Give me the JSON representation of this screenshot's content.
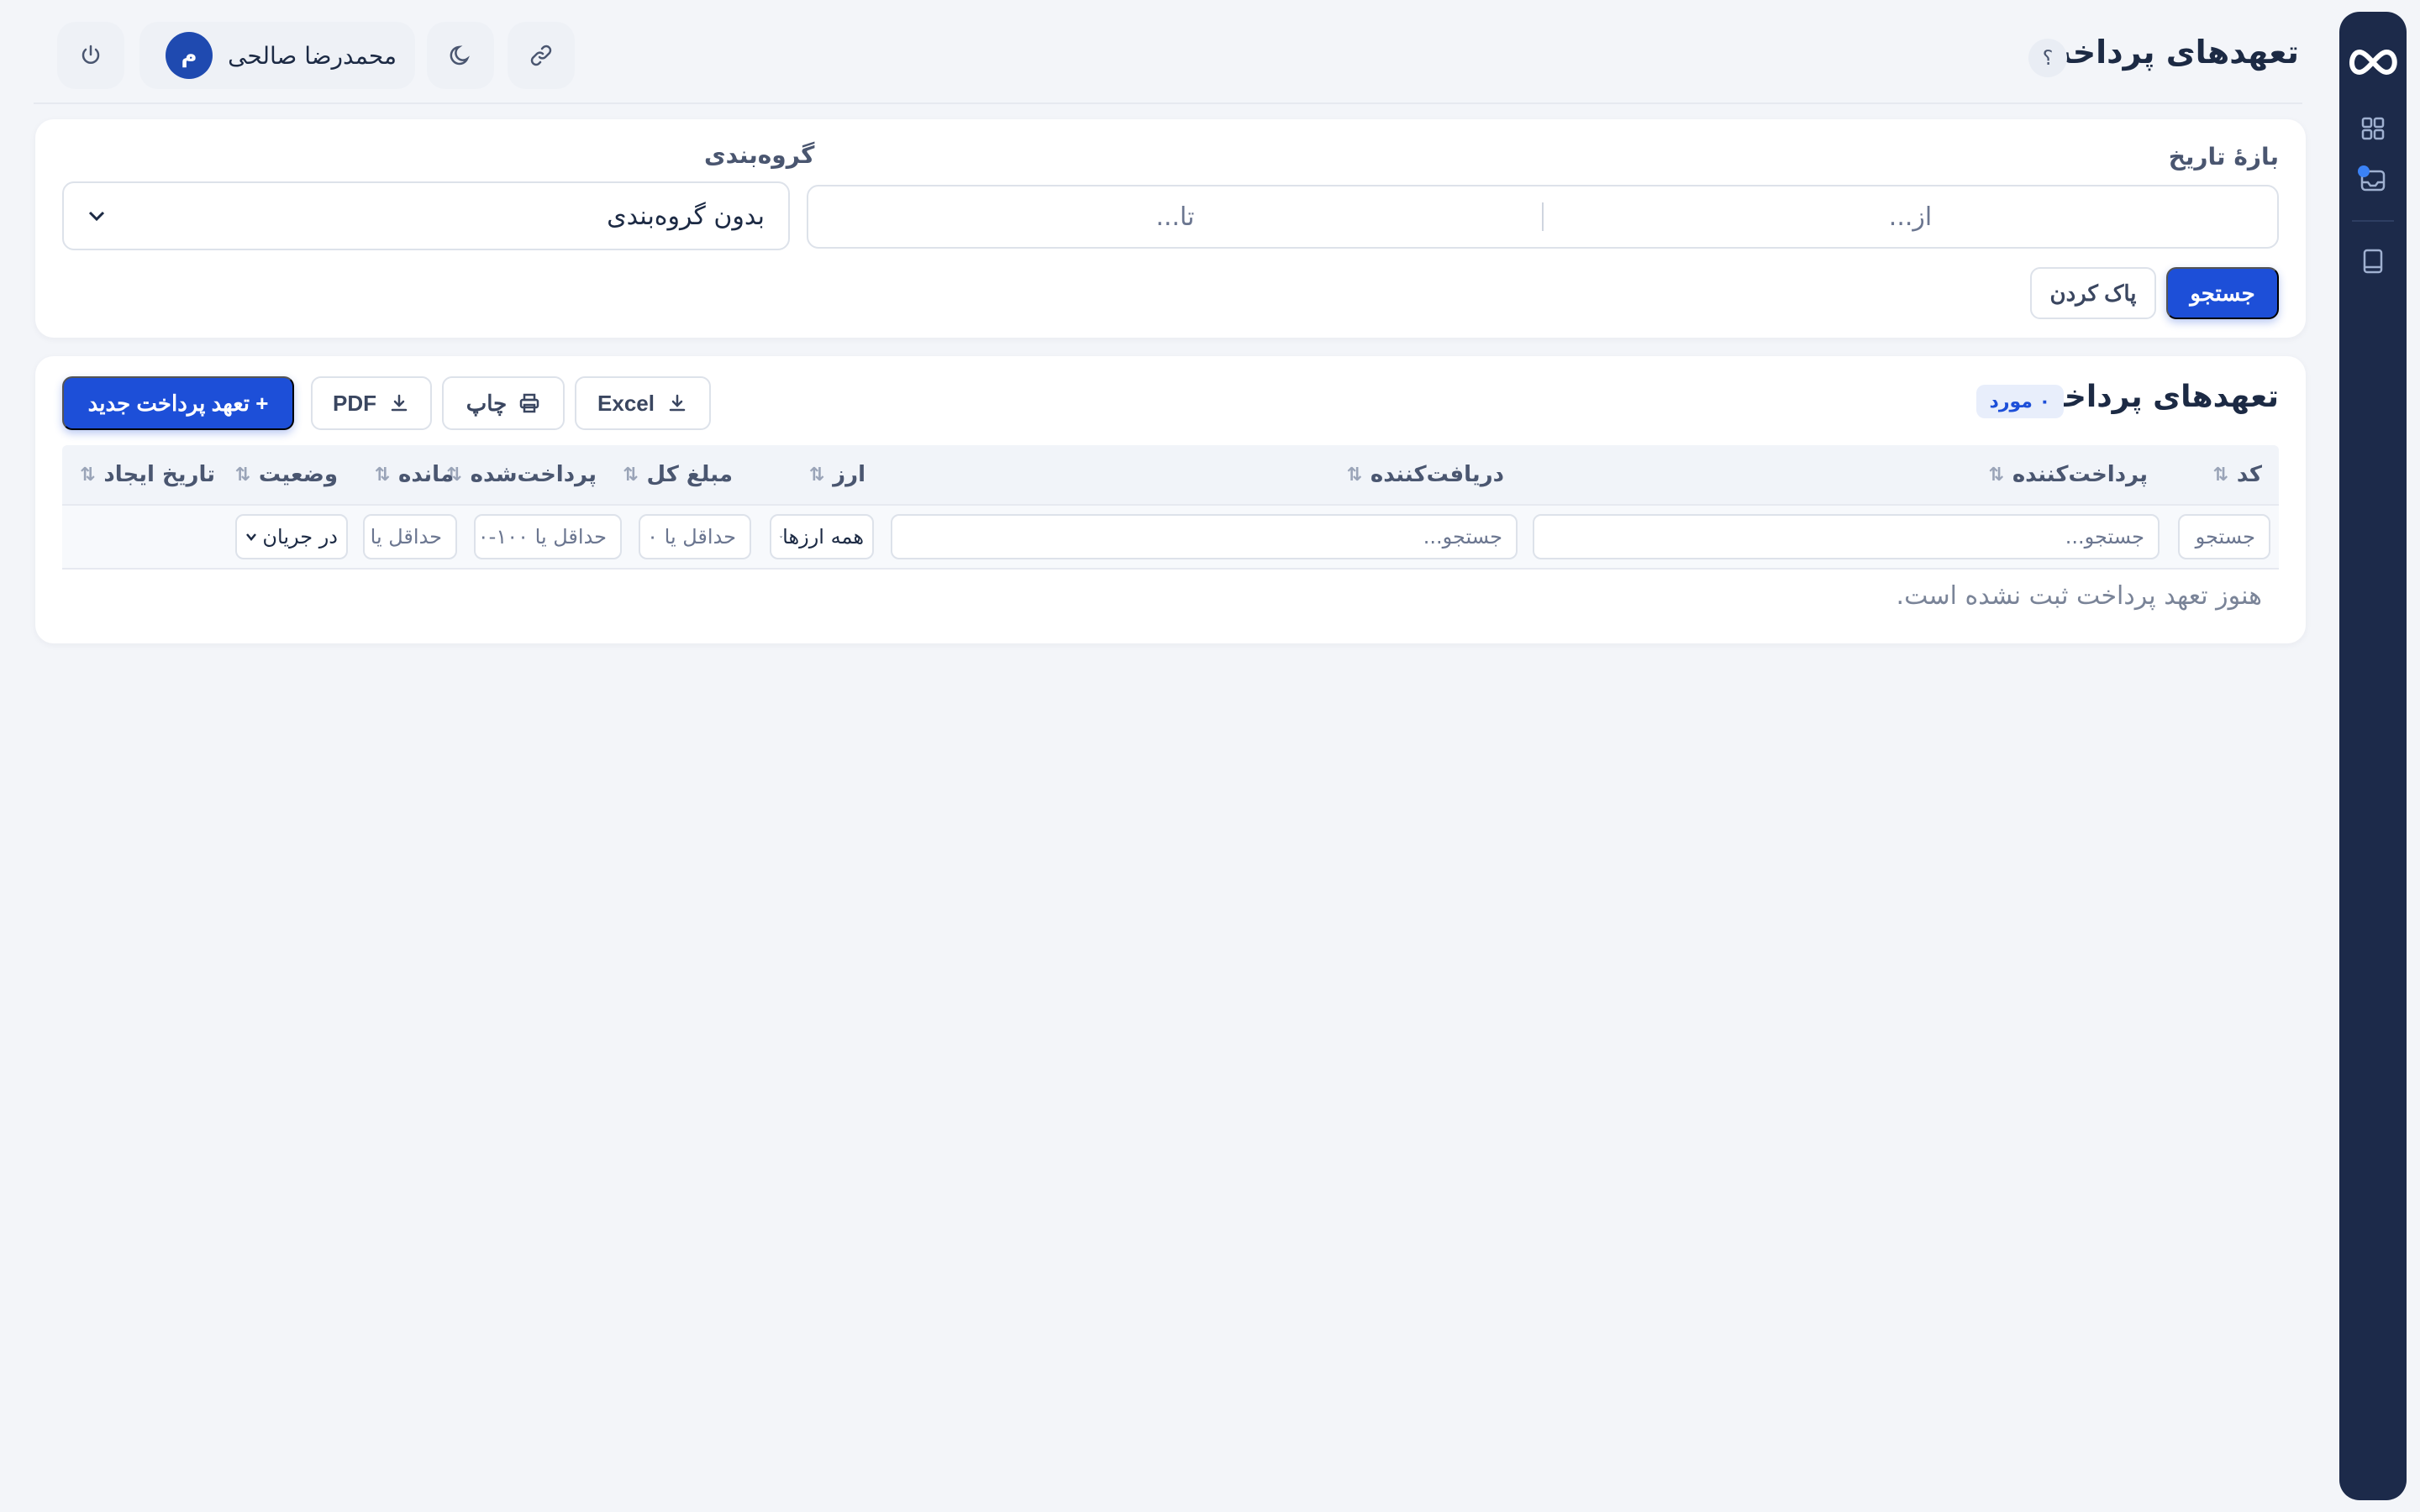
{
  "header": {
    "title": "تعهدهای پرداخت",
    "help_label": "؟",
    "user_initial": "م",
    "user_name": "محمدرضا صالحی"
  },
  "filters": {
    "date_range_label": "بازهٔ تاریخ",
    "date_from_placeholder": "از...",
    "date_to_placeholder": "تا...",
    "grouping_label": "گروه‌بندی",
    "grouping_value": "بدون گروه‌بندی",
    "search_button": "جستجو",
    "clear_button": "پاک کردن"
  },
  "table": {
    "title": "تعهدهای پرداخت",
    "count_badge": "۰ مورد",
    "new_button": "+ تعهد پرداخت جدید",
    "pdf_button": "PDF",
    "print_button": "چاپ",
    "excel_button": "Excel",
    "columns": {
      "code": "کد",
      "payer": "پرداخت‌کننده",
      "payee": "دریافت‌کننده",
      "currency": "ارز",
      "total": "مبلغ کل",
      "paid": "پرداخت‌شده",
      "remaining": "مانده",
      "status": "وضعیت",
      "created": "تاریخ ایجاد"
    },
    "filter_inputs": {
      "code": "جستجو",
      "payer": "جستجو...",
      "payee": "جستجو...",
      "currency": "همه ارزها",
      "total": "حداقل یا ۰",
      "paid": "حداقل یا ۱۰۰-۰",
      "remaining": "حداقل یا",
      "status": "در جریان"
    },
    "sort_glyph": "⇅",
    "empty_message": "هنوز تعهد پرداخت ثبت نشده است."
  },
  "colors": {
    "sidebar": "#1c2a4a",
    "primary": "#1d4fd8",
    "background": "#f3f5f9"
  },
  "icons": [
    "infinity-logo-icon",
    "dashboard-grid-icon",
    "inbox-icon",
    "book-icon",
    "power-icon",
    "moon-icon",
    "link-icon",
    "download-icon",
    "printer-icon",
    "chevron-down-icon"
  ]
}
